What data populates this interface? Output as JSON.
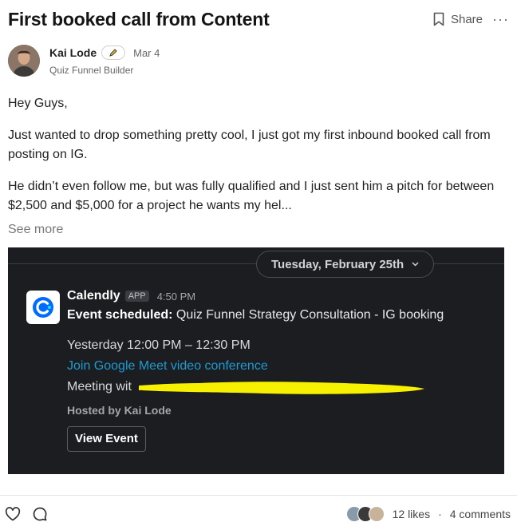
{
  "post": {
    "title": "First booked call from Content",
    "share_label": "Share",
    "more_label": "···"
  },
  "author": {
    "name": "Kai Lode",
    "date": "Mar 4",
    "role": "Quiz Funnel Builder"
  },
  "body": {
    "p1": "Hey Guys,",
    "p2": "Just wanted to drop something pretty cool, I just got my first inbound booked call from posting on IG.",
    "p3": "He didn’t even follow me, but was fully qualified and I just sent him a pitch for between $2,500 and $5,000 for a project he wants my hel...",
    "see_more": "See more"
  },
  "slack": {
    "day_label": "Tuesday, February 25th",
    "sender": "Calendly",
    "app_tag": "APP",
    "time": "4:50 PM",
    "event_prefix": "Event scheduled:",
    "event_name": " Quiz Funnel Strategy Consultation - IG booking",
    "when": "Yesterday 12:00 PM – 12:30 PM",
    "meet_link": "Join Google Meet video conference",
    "meeting_with": "Meeting wit",
    "hosted_by": "Hosted by Kai Lode",
    "view_event": "View Event",
    "colors": {
      "background": "#1b1d21",
      "link": "#1d9bd1",
      "highlighter": "#f7f000"
    }
  },
  "footer": {
    "likes": "12 likes",
    "separator": "·",
    "comments": "4 comments"
  }
}
